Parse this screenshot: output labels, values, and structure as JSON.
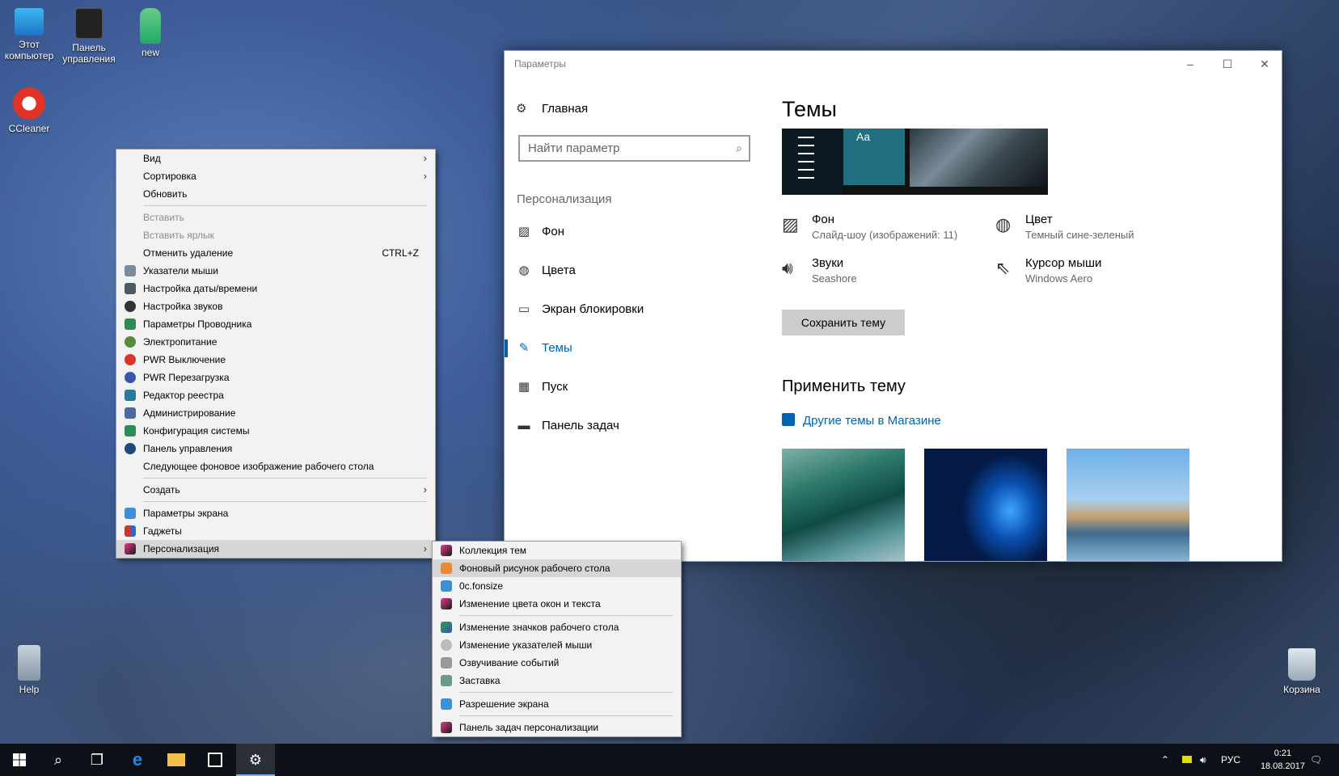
{
  "desktop": {
    "icons": [
      {
        "label": "Этот компьютер",
        "icon": "computer-icon"
      },
      {
        "label": "Панель управления",
        "icon": "control-panel-icon"
      },
      {
        "label": "new",
        "icon": "user-folder-icon"
      },
      {
        "label": "CCleaner",
        "icon": "ccleaner-icon"
      },
      {
        "label": "Help",
        "icon": "folder-icon"
      },
      {
        "label": "Корзина",
        "icon": "recycle-bin-icon"
      }
    ]
  },
  "context_menu": {
    "items": [
      {
        "label": "Вид",
        "submenu": true
      },
      {
        "label": "Сортировка",
        "submenu": true
      },
      {
        "label": "Обновить"
      },
      {
        "label": "Вставить",
        "disabled": true
      },
      {
        "label": "Вставить ярлык",
        "disabled": true
      },
      {
        "label": "Отменить удаление",
        "shortcut": "CTRL+Z"
      },
      {
        "label": "Указатели мыши"
      },
      {
        "label": "Настройка даты/времени"
      },
      {
        "label": "Настройка звуков"
      },
      {
        "label": "Параметры Проводника"
      },
      {
        "label": "Электропитание"
      },
      {
        "label": "PWR Выключение"
      },
      {
        "label": "PWR Перезагрузка"
      },
      {
        "label": "Редактор реестра"
      },
      {
        "label": "Администрирование"
      },
      {
        "label": "Конфигурация системы"
      },
      {
        "label": "Панель управления"
      },
      {
        "label": "Следующее фоновое изображение рабочего стола"
      },
      {
        "label": "Создать",
        "submenu": true
      },
      {
        "label": "Параметры экрана"
      },
      {
        "label": "Гаджеты"
      },
      {
        "label": "Персонализация",
        "submenu": true
      }
    ]
  },
  "submenu": {
    "items": [
      {
        "label": "Коллекция тем"
      },
      {
        "label": "Фоновый рисунок рабочего стола"
      },
      {
        "label": "0c.fonsize"
      },
      {
        "label": "Изменение цвета окон и текста"
      },
      {
        "label": "Изменение значков рабочего стола"
      },
      {
        "label": "Изменение указателей мыши"
      },
      {
        "label": "Озвучивание событий"
      },
      {
        "label": "Заставка"
      },
      {
        "label": "Разрешение экрана"
      },
      {
        "label": "Панель задач персонализации"
      }
    ]
  },
  "settings": {
    "title": "Параметры",
    "home": "Главная",
    "search_placeholder": "Найти параметр",
    "section": "Персонализация",
    "nav": [
      {
        "label": "Фон",
        "icon": "image-icon"
      },
      {
        "label": "Цвета",
        "icon": "palette-icon"
      },
      {
        "label": "Экран блокировки",
        "icon": "lock-screen-icon"
      },
      {
        "label": "Темы",
        "icon": "themes-icon",
        "active": true
      },
      {
        "label": "Пуск",
        "icon": "start-icon"
      },
      {
        "label": "Панель задач",
        "icon": "taskbar-icon"
      }
    ],
    "page_title": "Темы",
    "preview_text": "Aa",
    "props": {
      "background": {
        "name": "Фон",
        "value": "Слайд-шоу (изображений: 11)"
      },
      "color": {
        "name": "Цвет",
        "value": "Темный сине-зеленый"
      },
      "sounds": {
        "name": "Звуки",
        "value": "Seashore"
      },
      "cursor": {
        "name": "Курсор мыши",
        "value": "Windows Aero"
      }
    },
    "save_button": "Сохранить тему",
    "apply_title": "Применить тему",
    "store_link": "Другие темы в Магазине"
  },
  "taskbar": {
    "lang": "РУС",
    "time": "0:21",
    "date": "18.08.2017"
  },
  "colors": {
    "accent": "#0063b1",
    "menu_bg": "#f2f2f2",
    "taskbar_bg": "#0d1117"
  }
}
